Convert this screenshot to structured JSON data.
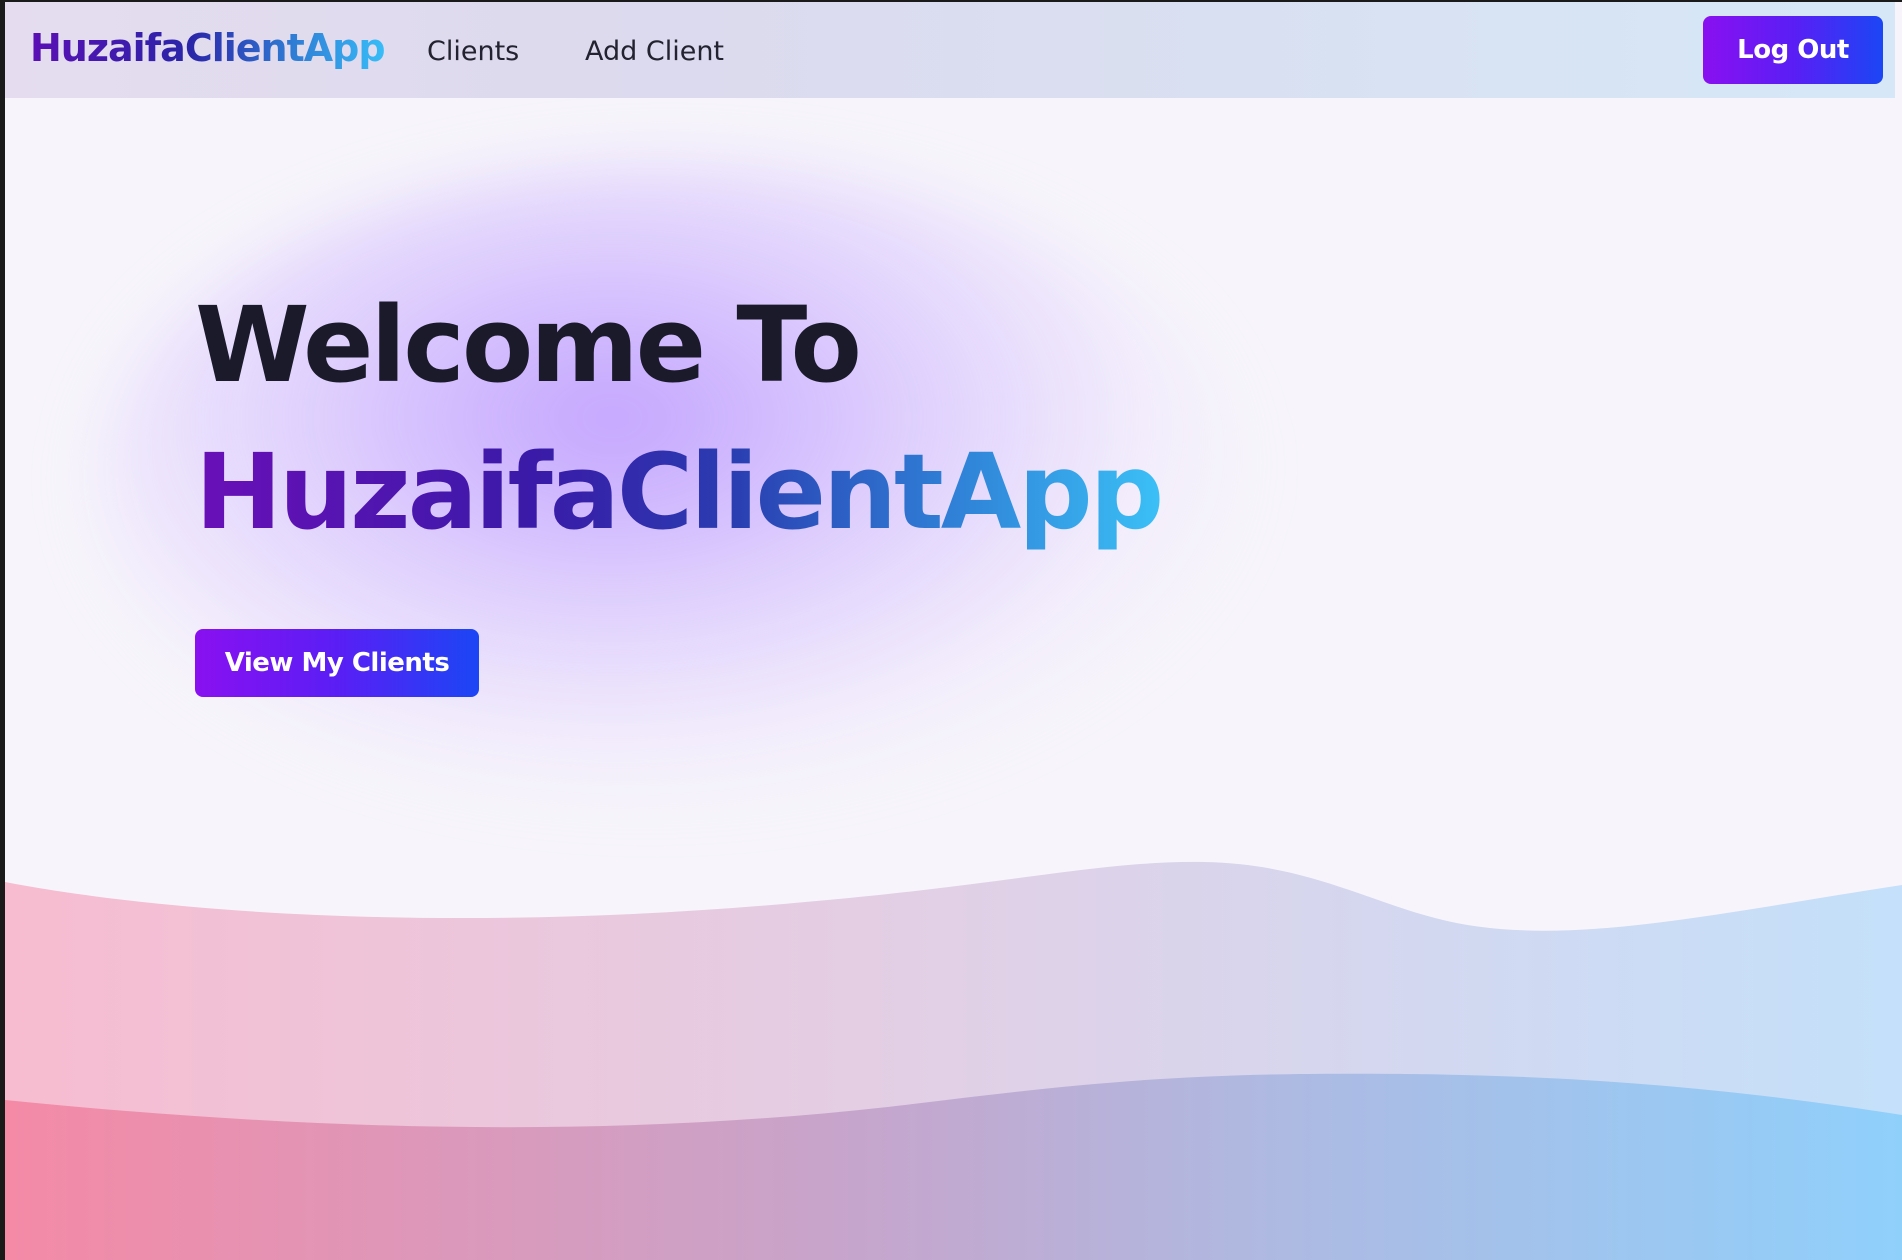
{
  "navbar": {
    "brand": "HuzaifaClientApp",
    "links": [
      {
        "label": "Clients"
      },
      {
        "label": "Add Client"
      }
    ],
    "logout_label": "Log Out"
  },
  "hero": {
    "title_line1": "Welcome To",
    "title_line2": "HuzaifaClientApp",
    "cta_label": "View My Clients"
  },
  "colors": {
    "accent_start": "#8a10f0",
    "accent_end": "#1b46f5",
    "brand_gradient_start": "#5b0fb5",
    "brand_gradient_end": "#38bdf8",
    "wave_pink": "#f48aa6",
    "wave_blue": "#8fd0fb"
  }
}
